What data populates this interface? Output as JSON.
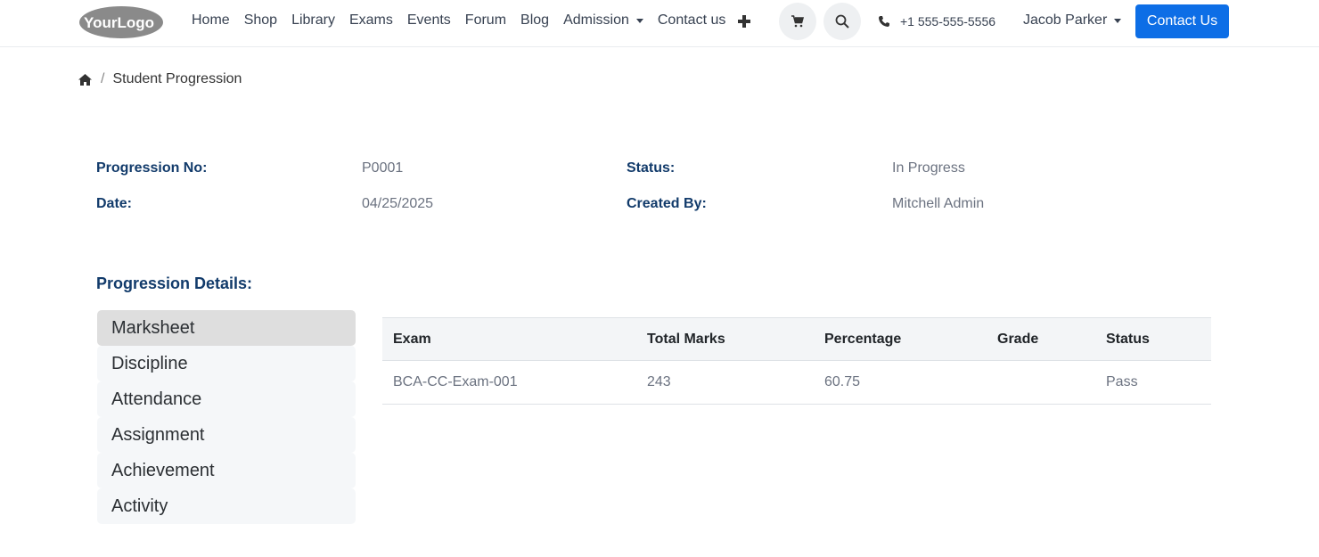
{
  "header": {
    "logo_text": "YourLogo",
    "nav": [
      {
        "label": "Home"
      },
      {
        "label": "Shop"
      },
      {
        "label": "Library"
      },
      {
        "label": "Exams"
      },
      {
        "label": "Events"
      },
      {
        "label": "Forum"
      },
      {
        "label": "Blog"
      },
      {
        "label": "Admission"
      },
      {
        "label": "Contact us"
      }
    ],
    "phone": "+1 555-555-5556",
    "user": "Jacob Parker",
    "cta": "Contact Us",
    "icons": [
      "plus-icon",
      "cart-icon",
      "search-icon",
      "phone-icon"
    ],
    "accent": "#0d6ee6"
  },
  "breadcrumb": {
    "current": "Student Progression"
  },
  "info": {
    "progression_no_label": "Progression No:",
    "progression_no": "P0001",
    "status_label": "Status:",
    "status": "In Progress",
    "date_label": "Date:",
    "date": "04/25/2025",
    "created_by_label": "Created By:",
    "created_by": "Mitchell Admin"
  },
  "details": {
    "title": "Progression Details:",
    "tabs": [
      {
        "label": "Marksheet"
      },
      {
        "label": "Discipline"
      },
      {
        "label": "Attendance"
      },
      {
        "label": "Assignment"
      },
      {
        "label": "Achievement"
      },
      {
        "label": "Activity"
      }
    ],
    "active_tab": "Marksheet"
  },
  "table": {
    "headers": [
      "Exam",
      "Total Marks",
      "Percentage",
      "Grade",
      "Status"
    ],
    "rows": [
      [
        "BCA-CC-Exam-001",
        "243",
        "60.75",
        "",
        "Pass"
      ]
    ]
  }
}
